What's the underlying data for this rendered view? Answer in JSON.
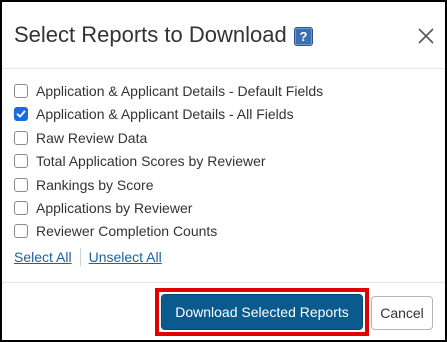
{
  "dialog": {
    "title": "Select Reports to Download",
    "help_icon": "help-icon",
    "help_glyph": "?",
    "close_icon": "close-icon"
  },
  "options": [
    {
      "label": "Application & Applicant Details - Default Fields",
      "checked": false
    },
    {
      "label": "Application & Applicant Details - All Fields",
      "checked": true
    },
    {
      "label": "Raw Review Data",
      "checked": false
    },
    {
      "label": "Total Application Scores by Reviewer",
      "checked": false
    },
    {
      "label": "Rankings by Score",
      "checked": false
    },
    {
      "label": "Applications by Reviewer",
      "checked": false
    },
    {
      "label": "Reviewer Completion Counts",
      "checked": false
    }
  ],
  "links": {
    "select_all": "Select All",
    "unselect_all": "Unselect All"
  },
  "footer": {
    "download_label": "Download Selected Reports",
    "cancel_label": "Cancel"
  },
  "colors": {
    "primary_button": "#0a5a8e",
    "checkbox_checked": "#1a6ae0",
    "highlight_border": "#e00000",
    "link": "#1f5f9e"
  }
}
